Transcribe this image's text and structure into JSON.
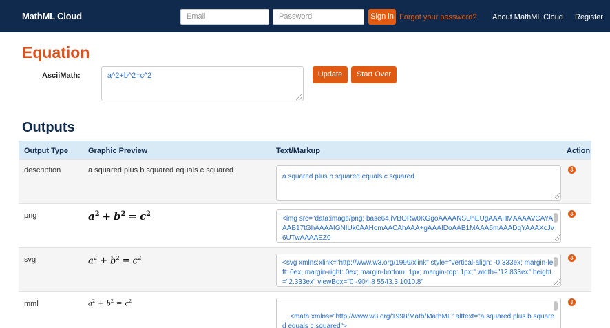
{
  "navbar": {
    "brand": "MathML Cloud",
    "email_placeholder": "Email",
    "password_placeholder": "Password",
    "signin_label": "Sign in",
    "forgot_label": "Forgot your password?",
    "about_label": "About MathML Cloud",
    "register_label": "Register"
  },
  "equation": {
    "heading": "Equation",
    "ascii_label": "AsciiMath:",
    "ascii_value": "a^2+b^2=c^2",
    "update_label": "Update",
    "start_over_label": "Start Over"
  },
  "outputs": {
    "heading": "Outputs",
    "columns": [
      "Output Type",
      "Graphic Preview",
      "Text/Markup",
      "Action"
    ],
    "rows": [
      {
        "type": "description",
        "preview": "a squared plus b squared equals c squared",
        "markup": "a squared plus b squared equals c squared"
      },
      {
        "type": "png",
        "preview_math": {
          "a": "a",
          "b": "b",
          "c": "c",
          "exp": "2",
          "plus": "+",
          "eq": "="
        },
        "markup": "<img src=\"data:image/png; base64,iVBORw0KGgoAAAANSUhEUgAAAHMAAAAVCAYAAAB17tGhAAAAIGNIUk0AAHomAACAhAAA+gAAAIDoAAB1MAAA6mAAADqYAAAXcJv6UTwAAAAEZ0"
      },
      {
        "type": "svg",
        "preview_math": {
          "a": "a",
          "b": "b",
          "c": "c",
          "exp": "2",
          "plus": "+",
          "eq": "="
        },
        "markup": "<svg xmlns:xlink=\"http://www.w3.org/1999/xlink\" style=\"vertical-align: -0.333ex; margin-left: 0ex; margin-right: 0ex; margin-bottom: 1px; margin-top: 1px;\" width=\"12.833ex\" height=\"2.333ex\" viewBox=\"0 -904.8 5543.3 1010.8\""
      },
      {
        "type": "mml",
        "preview_math": {
          "a": "a",
          "b": "b",
          "c": "c",
          "exp": "2",
          "plus": "+",
          "eq": "="
        },
        "markup": "<math xmlns=\"http://www.w3.org/1998/Math/MathML\" alttext=\"a squared plus b squared equals c squared\">\n<mstyle displaystyle=\"true\">"
      }
    ]
  },
  "colors": {
    "navbar": "#0f2a4d",
    "accent": "#e05a12",
    "heading_orange": "#d9531e",
    "table_header": "#d9eaf7",
    "markup_text": "#2a6fc9"
  },
  "icons": {
    "action": "download-circle-icon",
    "resize": "resize-grip-icon"
  }
}
